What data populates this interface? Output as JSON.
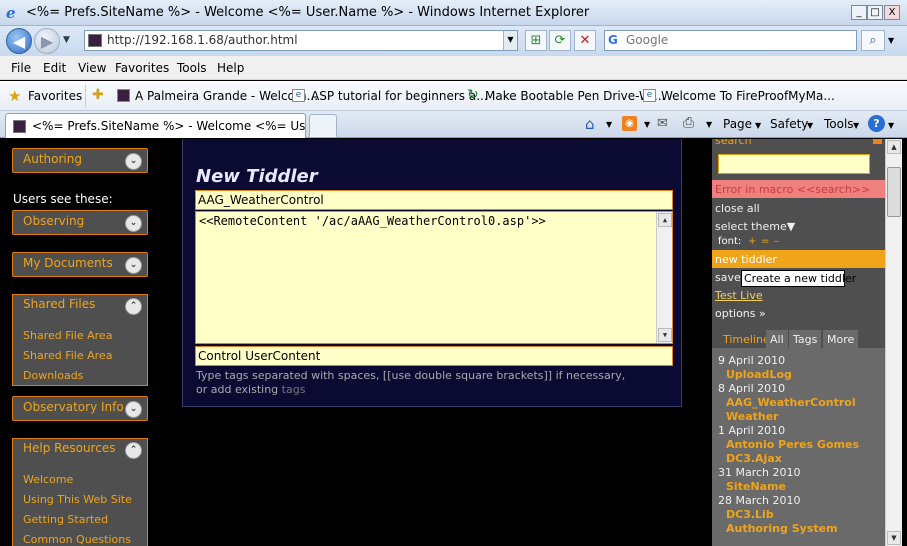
{
  "window": {
    "title": "<%= Prefs.SiteName %> - Welcome <%= User.Name %> - Windows Internet Explorer",
    "minimize": "_",
    "maximize": "□",
    "close": "X"
  },
  "address": {
    "url": "http://192.168.1.68/author.html",
    "search_placeholder": "Google",
    "back": "◀",
    "forward": "▶"
  },
  "menu": [
    "File",
    "Edit",
    "View",
    "Favorites",
    "Tools",
    "Help"
  ],
  "favorites": {
    "label": "Favorites",
    "links": [
      "A Palmeira Grande - Welcom...",
      "ASP tutorial for beginners a...",
      "Make Bootable Pen Drive-Wi...",
      "Welcome To FireProofMyMa..."
    ]
  },
  "tab": {
    "title": "<%= Prefs.SiteName %> - Welcome <%= User.Nam..."
  },
  "commandbar": {
    "page": "Page",
    "safety": "Safety",
    "tools": "Tools",
    "help": "?"
  },
  "sidebar": {
    "authoring": "Authoring",
    "users_see": "Users see these:",
    "observing": "Observing",
    "my_documents": "My Documents",
    "shared_files": {
      "label": "Shared Files",
      "items": [
        "Shared File Area",
        "Shared File Area",
        "Downloads"
      ]
    },
    "observatory_info": "Observatory Info",
    "help_resources": {
      "label": "Help Resources",
      "items": [
        "Welcome",
        "Using This Web Site",
        "Getting Started",
        "Common Questions"
      ]
    }
  },
  "editor": {
    "heading": "New Tiddler",
    "title_value": "AAG_WeatherControl",
    "body_value": "<<RemoteContent '/ac/aAAG_WeatherControl0.asp'>>",
    "tags_value": "Control UserContent",
    "help_text": "Type tags separated with spaces, [[use double square brackets]] if necessary, or add existing",
    "help_tags_link": "tags"
  },
  "rightpanel": {
    "search_label": "search",
    "error": "Error in macro <<search>>",
    "close_all": "close all",
    "select_theme": "select theme▼",
    "font_label": "font:",
    "font_plus": "+",
    "font_equal": "=",
    "font_minus": "–",
    "new_tiddler": "new tiddler",
    "save_changes": "save",
    "tooltip": "Create a new tiddler",
    "test_live": "Test Live",
    "options": "options »",
    "tabs": [
      "Timeline",
      "All",
      "Tags",
      "More"
    ],
    "timeline": [
      {
        "date": "9 April 2010",
        "items": [
          "UploadLog"
        ]
      },
      {
        "date": "8 April 2010",
        "items": [
          "AAG_WeatherControl",
          "Weather"
        ]
      },
      {
        "date": "1 April 2010",
        "items": [
          "Antonio Peres Gomes",
          "DC3.Ajax"
        ]
      },
      {
        "date": "31 March 2010",
        "items": [
          "SiteName"
        ]
      },
      {
        "date": "28 March 2010",
        "items": [
          "DC3.Lib",
          "Authoring System"
        ]
      }
    ]
  },
  "colors": {
    "accent": "#f0a419",
    "page_bg": "#000000",
    "panel_bg": "#4f4f4f",
    "field_bg": "#ffffc8"
  }
}
